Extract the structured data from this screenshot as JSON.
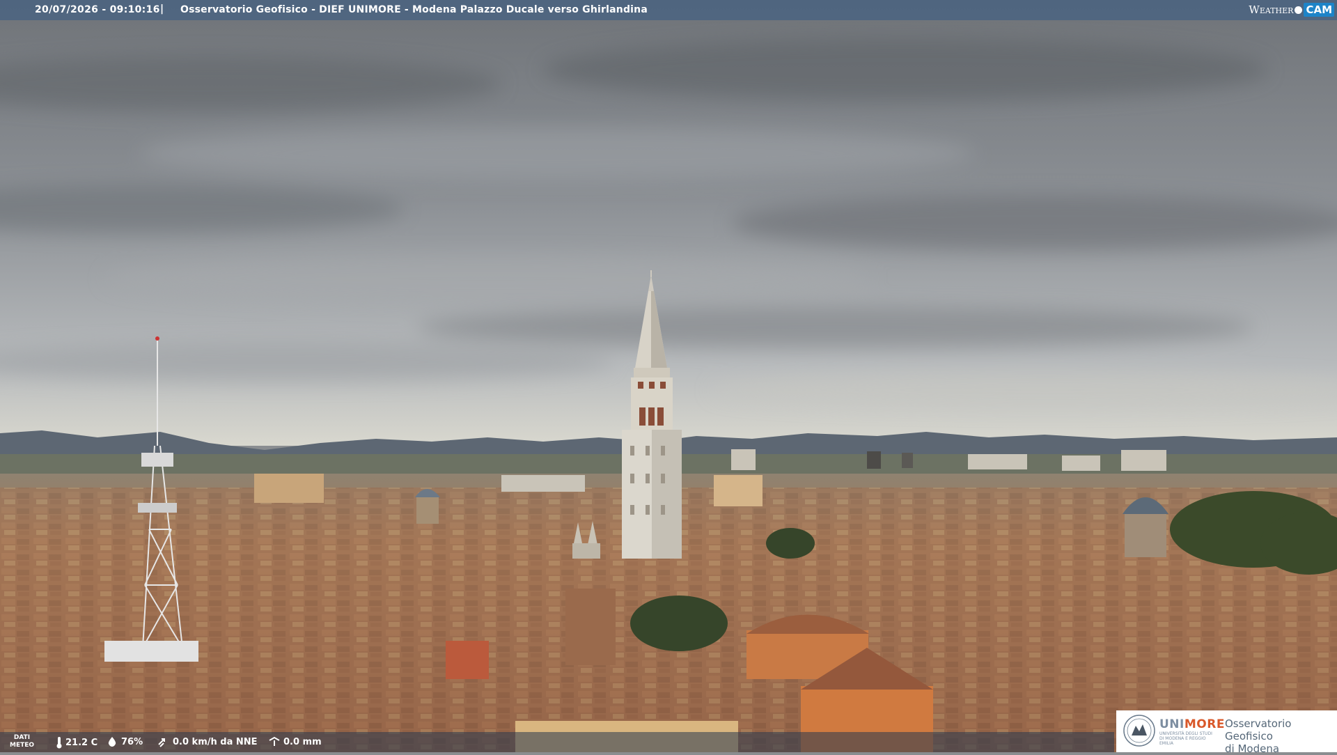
{
  "header": {
    "timestamp": "20/07/2026 - 09:10:16",
    "separator": "|",
    "title": "Osservatorio Geofisico - DIEF UNIMORE - Modena Palazzo Ducale verso Ghirlandina",
    "logo_word": "Weather",
    "logo_cam": "CAM"
  },
  "meteo": {
    "label_line1": "DATI",
    "label_line2": "METEO",
    "temperature": "21.2 C",
    "humidity": "76%",
    "wind": "0.0 km/h da NNE",
    "rain": "0.0 mm",
    "icons": [
      "thermometer-icon",
      "humidity-drop-icon",
      "wind-icon",
      "rain-gauge-icon"
    ]
  },
  "branding": {
    "uni_part1": "UNI",
    "uni_part2": "MORE",
    "uni_subtitle": "UNIVERSITÀ DEGLI STUDI DI MODENA E REGGIO EMILIA",
    "observatory_line1": "Osservatorio Geofisico",
    "observatory_line2": "di Modena",
    "colors": {
      "uni": "#7d8ea1",
      "more": "#d9582a",
      "cam": "#1e84c8"
    }
  }
}
